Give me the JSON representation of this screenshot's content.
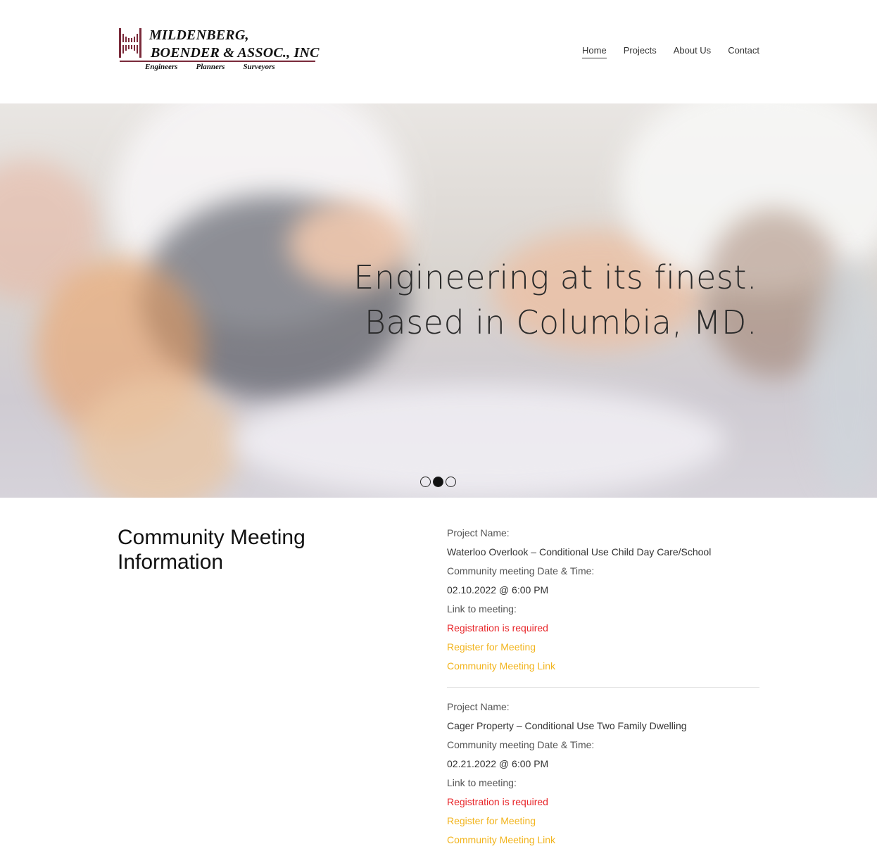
{
  "brand": {
    "line1": "MILDENBERG,",
    "line2": "BOENDER & ASSOC., INC",
    "tags": [
      "Engineers",
      "Planners",
      "Surveyors"
    ],
    "accent_color": "#7a2a3a"
  },
  "nav": {
    "items": [
      {
        "label": "Home",
        "active": true
      },
      {
        "label": "Projects",
        "active": false
      },
      {
        "label": "About Us",
        "active": false
      },
      {
        "label": "Contact",
        "active": false
      }
    ]
  },
  "hero": {
    "heading_line1": "Engineering at its finest.",
    "heading_line2": "Based in Columbia, MD.",
    "slides_count": 3,
    "active_slide": 2
  },
  "section": {
    "title": "Community Meeting Information"
  },
  "meetings": [
    {
      "project_label": "Project Name:",
      "project_name": "Waterloo Overlook – Conditional Use Child Day Care/School",
      "date_label": "Community meeting Date & Time:",
      "date_value": "02.10.2022 @ 6:00 PM",
      "link_label": "Link to meeting:",
      "registration_note": "Registration is required",
      "register_link": "Register for Meeting",
      "meeting_link": "Community Meeting Link"
    },
    {
      "project_label": "Project Name:",
      "project_name": "Cager Property – Conditional Use Two Family Dwelling",
      "date_label": "Community meeting Date & Time:",
      "date_value": "02.21.2022 @ 6:00 PM",
      "link_label": "Link to meeting:",
      "registration_note": "Registration is required",
      "register_link": "Register for Meeting",
      "meeting_link": "Community Meeting Link"
    }
  ],
  "colors": {
    "red_note": "#e8262a",
    "link": "#f2b41d"
  }
}
